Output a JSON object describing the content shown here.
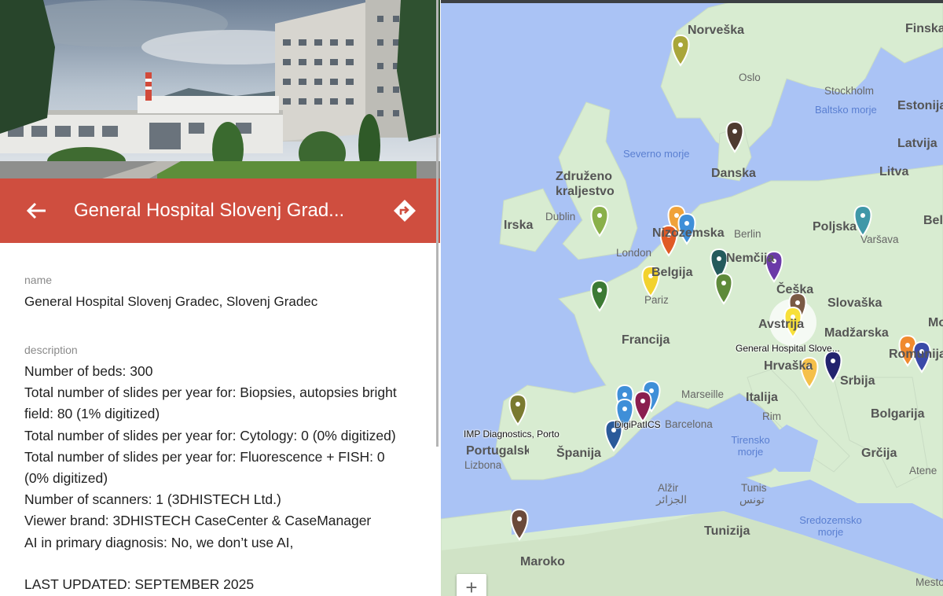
{
  "place": {
    "title": "General Hospital Slovenj Grad...",
    "fields": {
      "name_label": "name",
      "name_value": "General Hospital Slovenj Gradec, Slovenj Gradec",
      "description_label": "description"
    },
    "description_lines": [
      "Number of beds: 300",
      "Total number of slides per year for: Biopsies, autopsies bright",
      "field: 80 (1% digitized)",
      "Total number of slides per year for: Cytology: 0 (0% digitized)",
      "Total number of slides per year for: Fluorescence + FISH: 0",
      "(0% digitized)",
      "Number of scanners: 1 (3DHISTECH Ltd.)",
      "Viewer brand: 3DHISTECH CaseCenter & CaseManager",
      "AI in primary diagnosis: No, we don’t use AI,"
    ],
    "last_updated": "LAST UPDATED: SEPTEMBER 2025"
  },
  "icons": {
    "back": "arrow-left",
    "directions": "turn-right-diamond",
    "zoom_in": "+"
  },
  "colors": {
    "title_bar": "#cf4e3f",
    "map_water": "#aac3f5",
    "map_land": "#d8ecd1"
  },
  "map": {
    "countries": [
      "Norveška",
      "Finska",
      "Estonija",
      "Latvija",
      "Litva",
      "Danska",
      "Združeno",
      "kraljestvo",
      "Irska",
      "Poljska",
      "Belor",
      "Belgija",
      "Nemčija",
      "Češka",
      "Slovaška",
      "Madžarska",
      "Mol",
      "Francija",
      "Hrvaška",
      "Srbija",
      "Romunija",
      "Bolgarija",
      "Italija",
      "Grčija",
      "Portugalska",
      "Španija",
      "Maroko",
      "Tunizija",
      "Avstrija",
      "Nizozemska"
    ],
    "cities": [
      "Oslo",
      "Stockholm",
      "Dublin",
      "London",
      "Berlin",
      "Varšava",
      "Pariz",
      "Marseille",
      "Rim",
      "Barcelona",
      "Lizbona",
      "Atene",
      "Alžir",
      "الجزائر",
      "Tunis",
      "تونس",
      "Mesto"
    ],
    "seas": [
      "Baltsko morje",
      "Severno morje",
      "Tirensko morje",
      "Sredozemsko morje"
    ],
    "pin_labels": [
      "General Hospital Slove...",
      "IMP Diagnostics, Porto",
      "DigiPatICS"
    ],
    "zoom_in_label": "+"
  }
}
